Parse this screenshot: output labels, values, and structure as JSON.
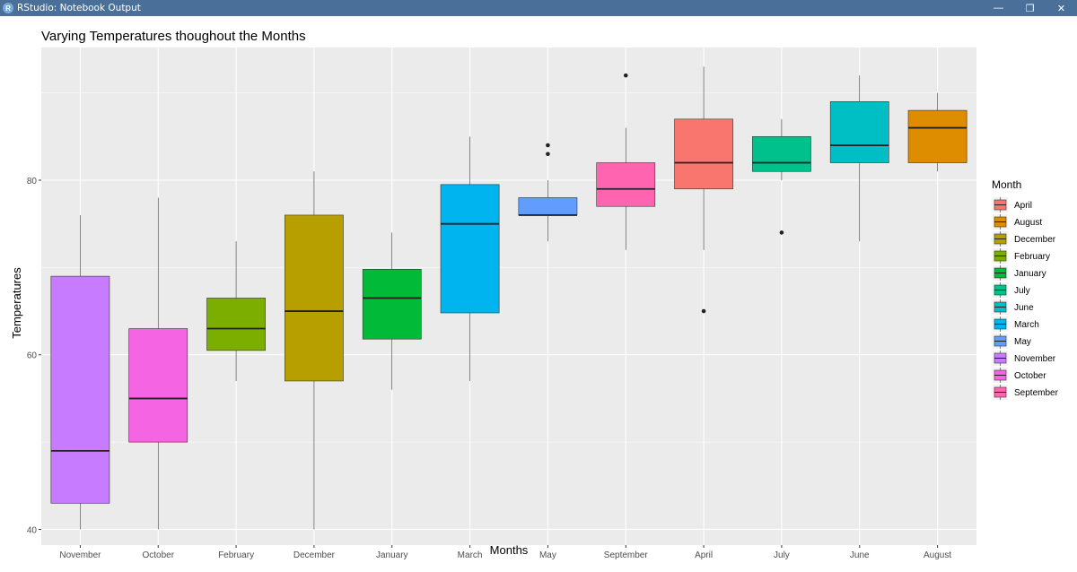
{
  "window": {
    "title": "RStudio: Notebook Output",
    "app_icon": "R",
    "controls": {
      "minimize": "—",
      "restore": "❐",
      "close": "✕"
    }
  },
  "chart_data": {
    "type": "boxplot",
    "title": "Varying Temperatures thoughout the Months",
    "xlabel": "Months",
    "ylabel": "Temperatures",
    "ylim": [
      38.2,
      95.2
    ],
    "yticks": [
      40,
      60,
      80
    ],
    "grid": true,
    "legend": {
      "title": "Month",
      "placement": "right",
      "entries": [
        {
          "label": "April",
          "color": "#F8766D"
        },
        {
          "label": "August",
          "color": "#DE8C00"
        },
        {
          "label": "December",
          "color": "#B79F00"
        },
        {
          "label": "February",
          "color": "#7CAE00"
        },
        {
          "label": "January",
          "color": "#00BA38"
        },
        {
          "label": "July",
          "color": "#00C08B"
        },
        {
          "label": "June",
          "color": "#00BFC4"
        },
        {
          "label": "March",
          "color": "#00B4F0"
        },
        {
          "label": "May",
          "color": "#619CFF"
        },
        {
          "label": "November",
          "color": "#C77CFF"
        },
        {
          "label": "October",
          "color": "#F564E3"
        },
        {
          "label": "September",
          "color": "#FF64B0"
        }
      ]
    },
    "categories": [
      "November",
      "October",
      "February",
      "December",
      "January",
      "March",
      "May",
      "September",
      "April",
      "July",
      "June",
      "August"
    ],
    "boxes": [
      {
        "category": "November",
        "min": 40,
        "q1": 43,
        "median": 49,
        "q3": 69,
        "max": 76,
        "outliers": [],
        "color": "#C77CFF"
      },
      {
        "category": "October",
        "min": 40,
        "q1": 50,
        "median": 55,
        "q3": 63,
        "max": 78,
        "outliers": [],
        "color": "#F564E3"
      },
      {
        "category": "February",
        "min": 57,
        "q1": 60.5,
        "median": 63,
        "q3": 66.5,
        "max": 73,
        "outliers": [],
        "color": "#7CAE00"
      },
      {
        "category": "December",
        "min": 40,
        "q1": 57,
        "median": 65,
        "q3": 76,
        "max": 81,
        "outliers": [],
        "color": "#B79F00"
      },
      {
        "category": "January",
        "min": 56,
        "q1": 61.8,
        "median": 66.5,
        "q3": 69.8,
        "max": 74,
        "outliers": [],
        "color": "#00BA38"
      },
      {
        "category": "March",
        "min": 57,
        "q1": 64.8,
        "median": 75,
        "q3": 79.5,
        "max": 85,
        "outliers": [],
        "color": "#00B4F0"
      },
      {
        "category": "May",
        "min": 73,
        "q1": 76,
        "median": 76,
        "q3": 78,
        "max": 80,
        "outliers": [
          83,
          84
        ],
        "color": "#619CFF"
      },
      {
        "category": "September",
        "min": 72,
        "q1": 77,
        "median": 79,
        "q3": 82,
        "max": 86,
        "outliers": [
          92
        ],
        "color": "#FF64B0"
      },
      {
        "category": "April",
        "min": 72,
        "q1": 79,
        "median": 82,
        "q3": 87,
        "max": 93,
        "outliers": [
          65
        ],
        "color": "#F8766D"
      },
      {
        "category": "July",
        "min": 80,
        "q1": 81,
        "median": 82,
        "q3": 85,
        "max": 87,
        "outliers": [
          74
        ],
        "color": "#00C08B"
      },
      {
        "category": "June",
        "min": 73,
        "q1": 82,
        "median": 84,
        "q3": 89,
        "max": 92,
        "outliers": [],
        "color": "#00BFC4"
      },
      {
        "category": "August",
        "min": 81,
        "q1": 82,
        "median": 86,
        "q3": 88,
        "max": 90,
        "outliers": [],
        "color": "#DE8C00"
      }
    ]
  }
}
